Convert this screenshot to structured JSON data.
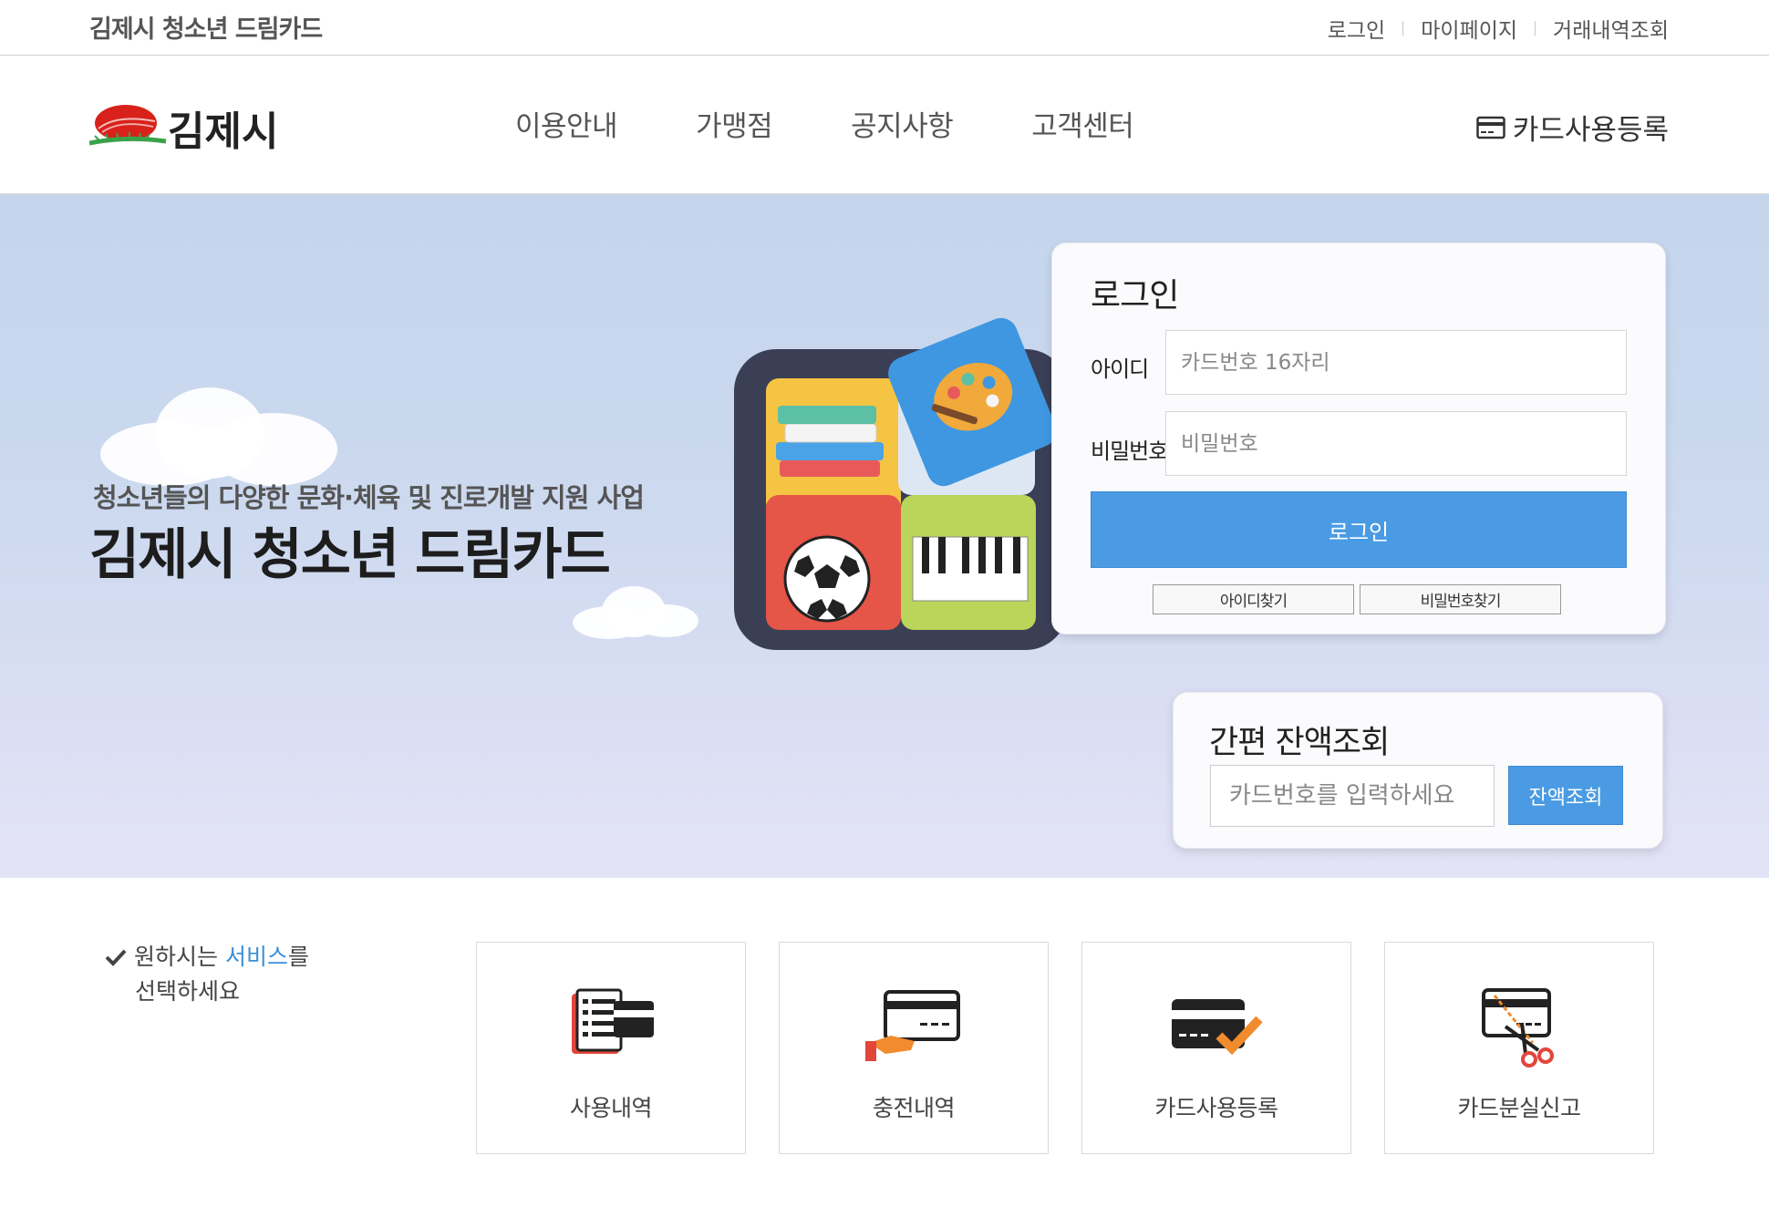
{
  "topbar": {
    "site_title": "김제시 청소년 드림카드",
    "links": [
      "로그인",
      "마이페이지",
      "거래내역조회"
    ]
  },
  "header": {
    "logo_text": "김제시",
    "nav": [
      "이용안내",
      "가맹점",
      "공지사항",
      "고객센터"
    ],
    "card_register": "카드사용등록"
  },
  "hero": {
    "subtitle": "청소년들의 다양한 문화·체육 및 진로개발 지원 사업",
    "title": "김제시 청소년 드림카드"
  },
  "login": {
    "title": "로그인",
    "id_label": "아이디",
    "id_placeholder": "카드번호 16자리",
    "pw_label": "비밀번호",
    "pw_placeholder": "비밀번호",
    "submit": "로그인",
    "find_id": "아이디찾기",
    "find_pw": "비밀번호찾기"
  },
  "balance": {
    "title": "간편 잔액조회",
    "placeholder": "카드번호를 입력하세요",
    "button": "잔액조회"
  },
  "services": {
    "intro_prefix": "원하시는 ",
    "intro_accent": "서비스",
    "intro_suffix": "를",
    "intro_line2": "선택하세요",
    "items": [
      {
        "label": "사용내역",
        "icon": "usage-history-icon"
      },
      {
        "label": "충전내역",
        "icon": "charge-history-icon"
      },
      {
        "label": "카드사용등록",
        "icon": "card-register-icon"
      },
      {
        "label": "카드분실신고",
        "icon": "card-lost-icon"
      }
    ]
  },
  "colors": {
    "accent": "#4a9be3",
    "hero_bg": "#c4d5ec",
    "icon_orange": "#f08c2e",
    "icon_red": "#e2463b"
  }
}
